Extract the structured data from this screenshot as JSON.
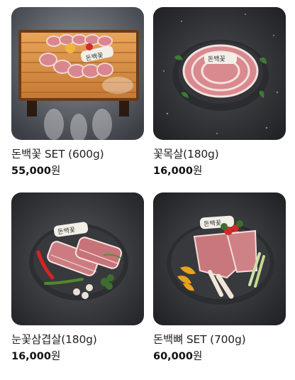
{
  "products": [
    {
      "name": "돈백꽃 SET (600g)",
      "price": "55,000",
      "currency": "원",
      "image_icon": "pork-set-on-wooden-board"
    },
    {
      "name": "꽃목살(180g)",
      "price": "16,000",
      "currency": "원",
      "image_icon": "pork-neck-on-plate"
    },
    {
      "name": "눈꽃삼겹살(180g)",
      "price": "16,000",
      "currency": "원",
      "image_icon": "pork-belly-on-plate"
    },
    {
      "name": "돈백뼈 SET (700g)",
      "price": "60,000",
      "currency": "원",
      "image_icon": "pork-bone-set-on-plate"
    }
  ],
  "logo_text": "돈백꽃"
}
